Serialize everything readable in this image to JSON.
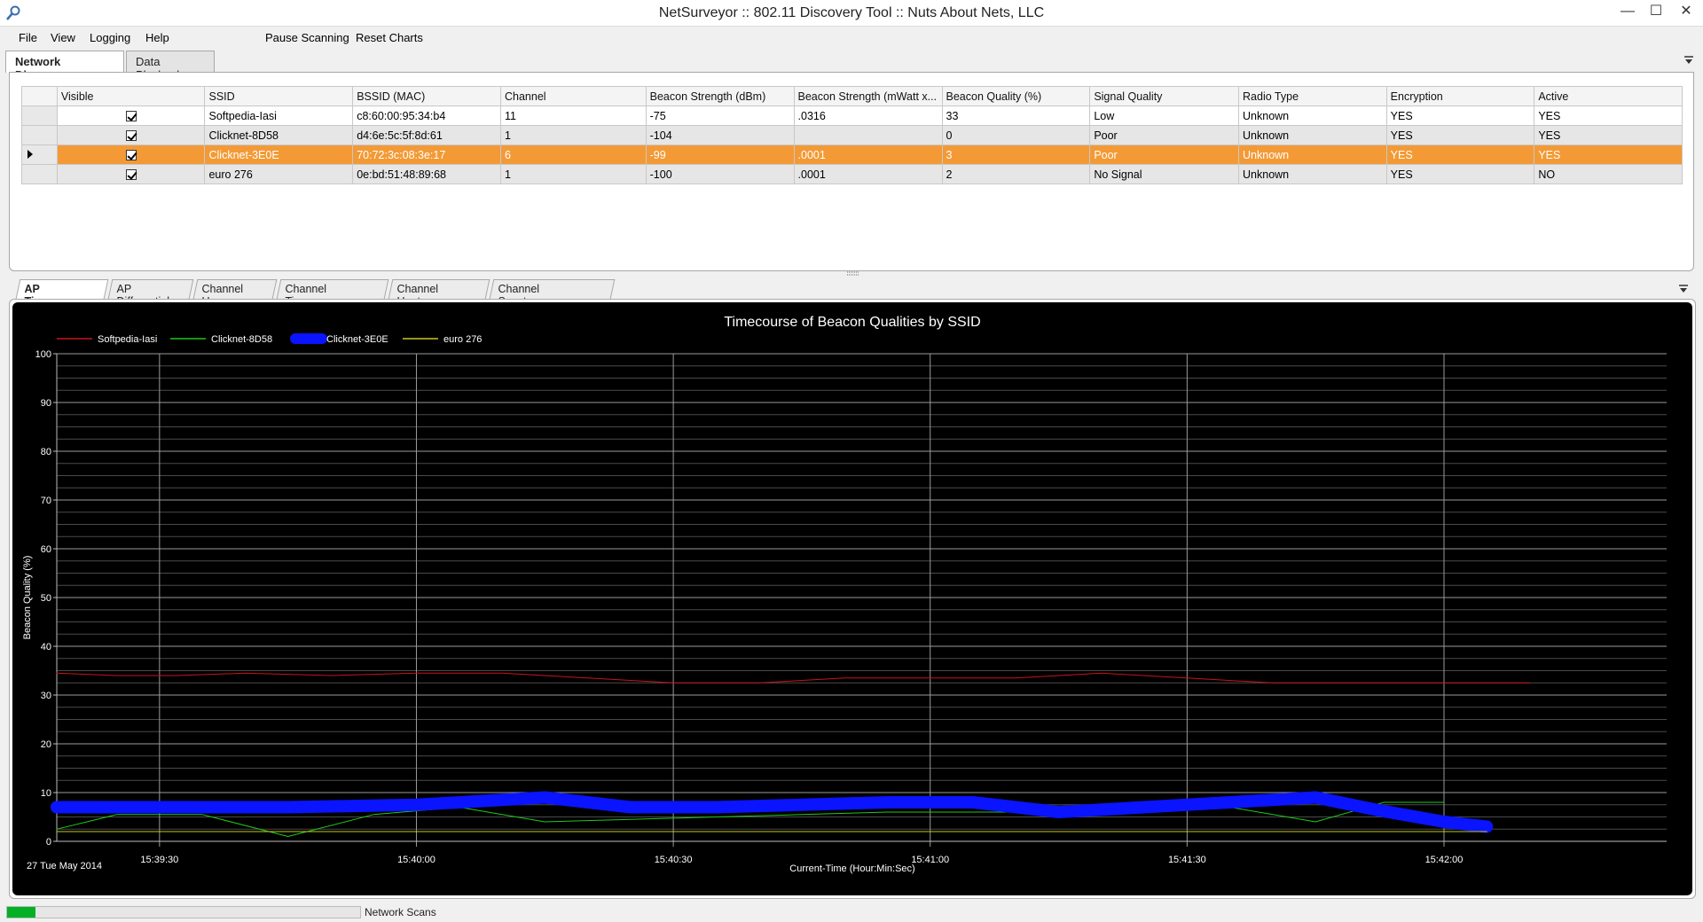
{
  "window": {
    "title": "NetSurveyor :: 802.11 Discovery Tool :: Nuts About Nets, LLC",
    "icon": "search-icon",
    "minimize": "—",
    "maximize": "☐",
    "close": "✕"
  },
  "menu": {
    "file": "File",
    "view": "View",
    "logging": "Logging",
    "help": "Help",
    "pause": "Pause Scanning",
    "reset": "Reset Charts"
  },
  "top_tabs": [
    "Network Discovery",
    "Data Playback"
  ],
  "table": {
    "columns": [
      "Visible",
      "SSID",
      "BSSID (MAC)",
      "Channel",
      "Beacon Strength (dBm)",
      "Beacon Strength (mWatt x...",
      "Beacon Quality (%)",
      "Signal Quality",
      "Radio Type",
      "Encryption",
      "Active"
    ],
    "rows": [
      {
        "visible": true,
        "ssid": "Softpedia-Iasi",
        "bssid": "c8:60:00:95:34:b4",
        "channel": "11",
        "dbm": "-75",
        "mwatt": ".0316",
        "quality": "33",
        "signal": "Low",
        "radio": "Unknown",
        "enc": "YES",
        "active": "YES"
      },
      {
        "visible": true,
        "ssid": "Clicknet-8D58",
        "bssid": "d4:6e:5c:5f:8d:61",
        "channel": "1",
        "dbm": "-104",
        "mwatt": "",
        "quality": "0",
        "signal": "Poor",
        "radio": "Unknown",
        "enc": "YES",
        "active": "YES"
      },
      {
        "visible": true,
        "ssid": "Clicknet-3E0E",
        "bssid": "70:72:3c:08:3e:17",
        "channel": "6",
        "dbm": "-99",
        "mwatt": ".0001",
        "quality": "3",
        "signal": "Poor",
        "radio": "Unknown",
        "enc": "YES",
        "active": "YES"
      },
      {
        "visible": true,
        "ssid": "euro 276",
        "bssid": "0e:bd:51:48:89:68",
        "channel": "1",
        "dbm": "-100",
        "mwatt": ".0001",
        "quality": "2",
        "signal": "No Signal",
        "radio": "Unknown",
        "enc": "YES",
        "active": "NO"
      }
    ],
    "selected_row": 2
  },
  "chart_tabs": [
    "AP Timecourse",
    "AP Differential",
    "Channel Usage",
    "Channel Timecourse",
    "Channel Heatmap",
    "Channel Spectrogram"
  ],
  "status": {
    "progress": 0.08,
    "label": "Network Scans"
  },
  "colors": {
    "selected_row": "#f39a36",
    "chart_bg": "#000000",
    "softpedia": "#c8141e",
    "clicknet_8d58": "#1ec81e",
    "clicknet_3e0e": "#0a14ff",
    "euro276": "#c8c81e"
  },
  "chart_data": {
    "type": "line",
    "title": "Timecourse of Beacon Qualities by SSID",
    "xlabel": "Current-Time (Hour:Min:Sec)",
    "ylabel": "Beacon Quality (%)",
    "date_label": "27 Tue May 2014",
    "ylim": [
      0,
      100
    ],
    "yticks": [
      0,
      10,
      20,
      30,
      40,
      50,
      60,
      70,
      80,
      90,
      100
    ],
    "x_range": [
      "15:39:18",
      "15:42:26"
    ],
    "xticks": [
      "15:39:30",
      "15:40:00",
      "15:40:30",
      "15:41:00",
      "15:41:30",
      "15:42:00"
    ],
    "grid": true,
    "legend": "top-left",
    "series": [
      {
        "name": "Softpedia-Iasi",
        "color": "#c8141e",
        "width": 1,
        "x": [
          "15:39:18",
          "15:39:25",
          "15:39:32",
          "15:39:40",
          "15:39:50",
          "15:40:00",
          "15:40:10",
          "15:40:20",
          "15:40:30",
          "15:40:40",
          "15:40:50",
          "15:41:00",
          "15:41:10",
          "15:41:20",
          "15:41:30",
          "15:41:40",
          "15:41:50",
          "15:42:00",
          "15:42:10"
        ],
        "values": [
          34.5,
          34,
          34,
          34.5,
          34,
          34.5,
          34.5,
          33.5,
          32.5,
          32.5,
          33.5,
          33.5,
          33.5,
          34.5,
          33.5,
          32.5,
          32.5,
          32.5,
          32.5
        ]
      },
      {
        "name": "Clicknet-8D58",
        "color": "#1ec81e",
        "width": 1,
        "x": [
          "15:39:18",
          "15:39:25",
          "15:39:35",
          "15:39:45",
          "15:39:55",
          "15:40:05",
          "15:40:15",
          "15:40:25",
          "15:40:35",
          "15:40:45",
          "15:40:55",
          "15:41:05",
          "15:41:15",
          "15:41:25",
          "15:41:35",
          "15:41:45",
          "15:41:53",
          "15:42:00"
        ],
        "values": [
          2.5,
          5.5,
          5.5,
          1,
          5.5,
          7,
          4,
          4.5,
          5,
          5.5,
          6,
          6,
          6,
          7,
          7,
          4,
          8,
          8
        ]
      },
      {
        "name": "Clicknet-3E0E",
        "color": "#0a14ff",
        "width": 14,
        "x": [
          "15:39:18",
          "15:39:30",
          "15:39:45",
          "15:40:00",
          "15:40:10",
          "15:40:15",
          "15:40:25",
          "15:40:35",
          "15:40:45",
          "15:40:55",
          "15:41:05",
          "15:41:15",
          "15:41:25",
          "15:41:35",
          "15:41:45",
          "15:41:52",
          "15:42:00",
          "15:42:05"
        ],
        "values": [
          7,
          7,
          7,
          7.5,
          8.5,
          9,
          7,
          7,
          7.5,
          8,
          8,
          6,
          7,
          8,
          9,
          6.5,
          4,
          3
        ]
      },
      {
        "name": "euro 276",
        "color": "#c8c81e",
        "width": 1,
        "x": [
          "15:39:18",
          "15:42:05"
        ],
        "values": [
          2,
          2
        ]
      }
    ]
  }
}
